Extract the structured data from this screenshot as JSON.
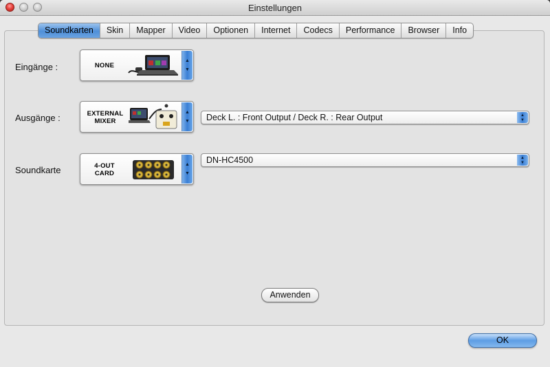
{
  "window": {
    "title": "Einstellungen"
  },
  "tabs": [
    {
      "label": "Soundkarten",
      "active": true
    },
    {
      "label": "Skin"
    },
    {
      "label": "Mapper"
    },
    {
      "label": "Video"
    },
    {
      "label": "Optionen"
    },
    {
      "label": "Internet"
    },
    {
      "label": "Codecs"
    },
    {
      "label": "Performance"
    },
    {
      "label": "Browser"
    },
    {
      "label": "Info"
    }
  ],
  "inputs": {
    "label": "Eingänge :",
    "picker": "NONE"
  },
  "outputs": {
    "label": "Ausgänge :",
    "picker_line1": "EXTERNAL",
    "picker_line2": "MIXER",
    "select_value": "Deck L. : Front Output / Deck R. : Rear Output"
  },
  "soundcard": {
    "label": "Soundkarte",
    "picker_line1": "4-OUT",
    "picker_line2": "CARD",
    "select_value": "DN-HC4500"
  },
  "buttons": {
    "apply": "Anwenden",
    "ok": "OK"
  },
  "colors": {
    "accent": "#3a7fd5",
    "active_tab": "#6aa3e2"
  }
}
